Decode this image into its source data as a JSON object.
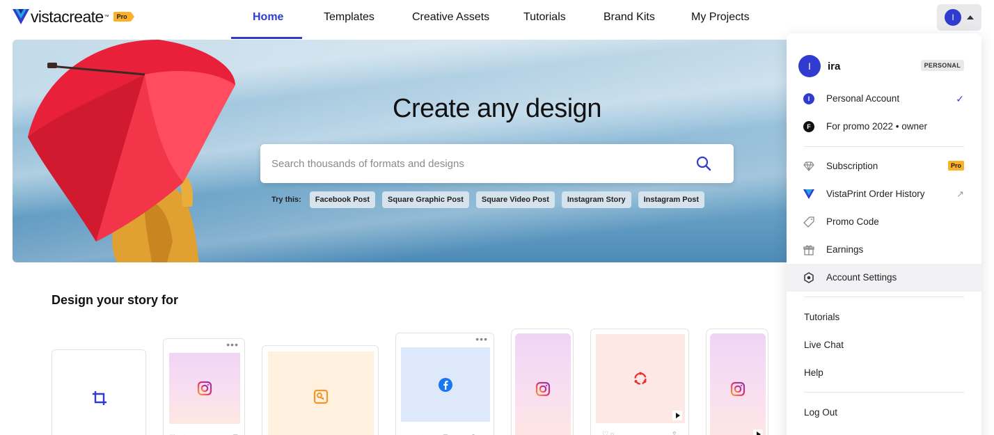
{
  "brand": {
    "name": "vistacreate",
    "tm": "™",
    "pro_badge": "Pro"
  },
  "nav": {
    "items": [
      {
        "label": "Home",
        "active": true
      },
      {
        "label": "Templates"
      },
      {
        "label": "Creative Assets"
      },
      {
        "label": "Tutorials"
      },
      {
        "label": "Brand Kits"
      },
      {
        "label": "My Projects"
      }
    ]
  },
  "account": {
    "initial": "I"
  },
  "hero": {
    "title": "Create any design",
    "search_placeholder": "Search thousands of formats and designs",
    "try_label": "Try this:",
    "chips": [
      "Facebook Post",
      "Square Graphic Post",
      "Square Video Post",
      "Instagram Story",
      "Instagram Post"
    ]
  },
  "section": {
    "title": "Design your story for"
  },
  "dropdown": {
    "user": {
      "initial": "I",
      "name": "ira",
      "plan": "PERSONAL"
    },
    "accounts": [
      {
        "initial": "I",
        "label": "Personal Account",
        "color": "#2f3ccf",
        "checked": true
      },
      {
        "initial": "F",
        "label": "For promo 2022 • owner",
        "color": "#111111"
      }
    ],
    "menu": [
      {
        "icon": "diamond-icon",
        "label": "Subscription",
        "badge": "Pro"
      },
      {
        "icon": "vistaprint-icon",
        "label": "VistaPrint Order History",
        "external": true
      },
      {
        "icon": "tag-icon",
        "label": "Promo Code"
      },
      {
        "icon": "gift-icon",
        "label": "Earnings"
      },
      {
        "icon": "settings-icon",
        "label": "Account Settings"
      }
    ],
    "support": [
      "Tutorials",
      "Live Chat",
      "Help"
    ],
    "logout": "Log Out"
  },
  "colors": {
    "accent": "#2f3ccf",
    "pro": "#fbb027",
    "umbrella": "#e8203a"
  }
}
